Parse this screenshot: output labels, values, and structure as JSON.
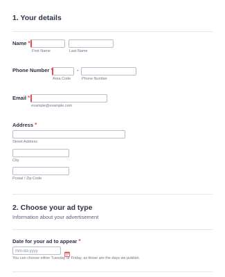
{
  "section1": {
    "title": "1. Your details"
  },
  "name": {
    "label": "Name",
    "required": "*",
    "first_sub": "First Name",
    "last_sub": "Last Name"
  },
  "phone": {
    "label": "Phone Number",
    "required": "*",
    "separator": "-",
    "area_sub": "Area Code",
    "number_sub": "Phone Number"
  },
  "email": {
    "label": "Email",
    "required": "*",
    "help": "example@example.com"
  },
  "address": {
    "label": "Address",
    "required": "*",
    "street_sub": "Street Address",
    "city_sub": "City",
    "postal_sub": "Postal / Zip Code"
  },
  "section2": {
    "title": "2. Choose your ad type",
    "subtitle": "Information about your advertisement"
  },
  "date": {
    "label": "Date for your ad to appear",
    "required": "*",
    "placeholder": "mm-dd-yyyy",
    "help": "You can choose either Tuesday or Friday, as those are the days we publish."
  },
  "colors": {
    "required": "#e94a4a",
    "border": "#b8bdc9",
    "text": "#2c3345",
    "calendar": "#d9534f"
  }
}
